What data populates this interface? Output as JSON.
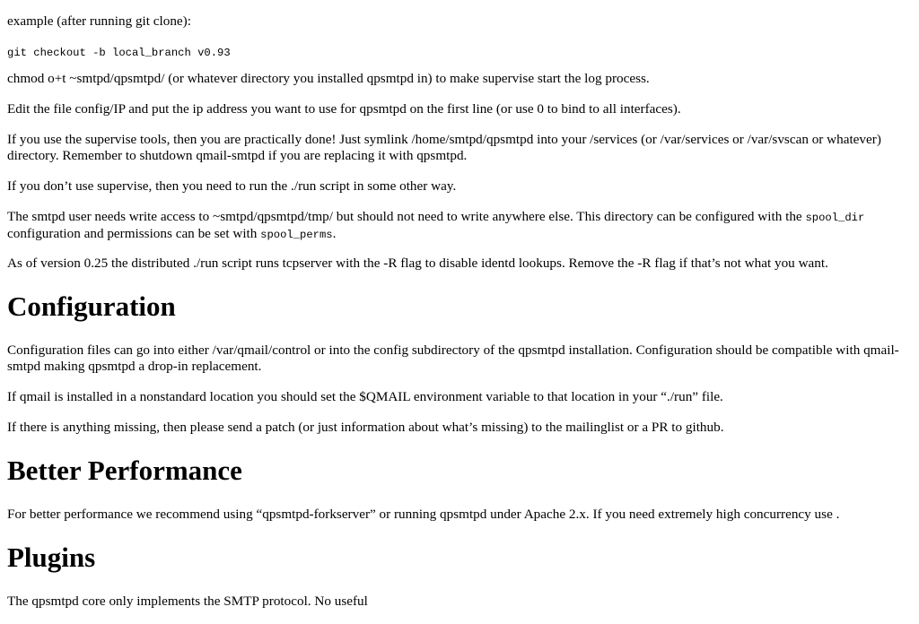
{
  "paragraphs": {
    "p1": "example (after running git clone):",
    "p2_code": "git checkout -b local_branch v0.93",
    "p3": "chmod o+t ~smtpd/qpsmtpd/ (or whatever directory you installed qpsmtpd in) to make supervise start the log process.",
    "p4": "Edit the file config/IP and put the ip address you want to use for qpsmtpd on the first line (or use 0 to bind to all interfaces).",
    "p5": "If you use the supervise tools, then you are practically done! Just symlink /home/smtpd/qpsmtpd into your /services (or /var/services or /var/svscan or whatever) directory. Remember to shutdown qmail-smtpd if you are replacing it with qpsmtpd.",
    "p6": "If you don’t use supervise, then you need to run the ./run script in some other way.",
    "p7_a": "The smtpd user needs write access to ~smtpd/qpsmtpd/tmp/ but should not need to write anywhere else. This directory can be configured with the ",
    "p7_code1": "spool_dir",
    "p7_b": " configuration and permissions can be set with ",
    "p7_code2": "spool_perms",
    "p7_c": ".",
    "p8": "As of version 0.25 the distributed ./run script runs tcpserver with the -R flag to disable identd lookups. Remove the -R flag if that’s not what you want."
  },
  "configuration": {
    "heading": "Configuration",
    "p1": "Configuration files can go into either /var/qmail/control or into the config subdirectory of the qpsmtpd installation. Configuration should be compatible with qmail-smtpd making qpsmtpd a drop-in replacement.",
    "p2": "If qmail is installed in a nonstandard location you should set the $QMAIL environment variable to that location in your “./run” file.",
    "p3": "If there is anything missing, then please send a patch (or just information about what’s missing) to the mailinglist or a PR to github."
  },
  "performance": {
    "heading": "Better Performance",
    "p1": "For better performance we recommend using “qpsmtpd-forkserver” or running qpsmtpd under Apache 2.x. If you need extremely high concurrency use ."
  },
  "plugins": {
    "heading": "Plugins",
    "p1": "The qpsmtpd core only implements the SMTP protocol. No useful"
  }
}
